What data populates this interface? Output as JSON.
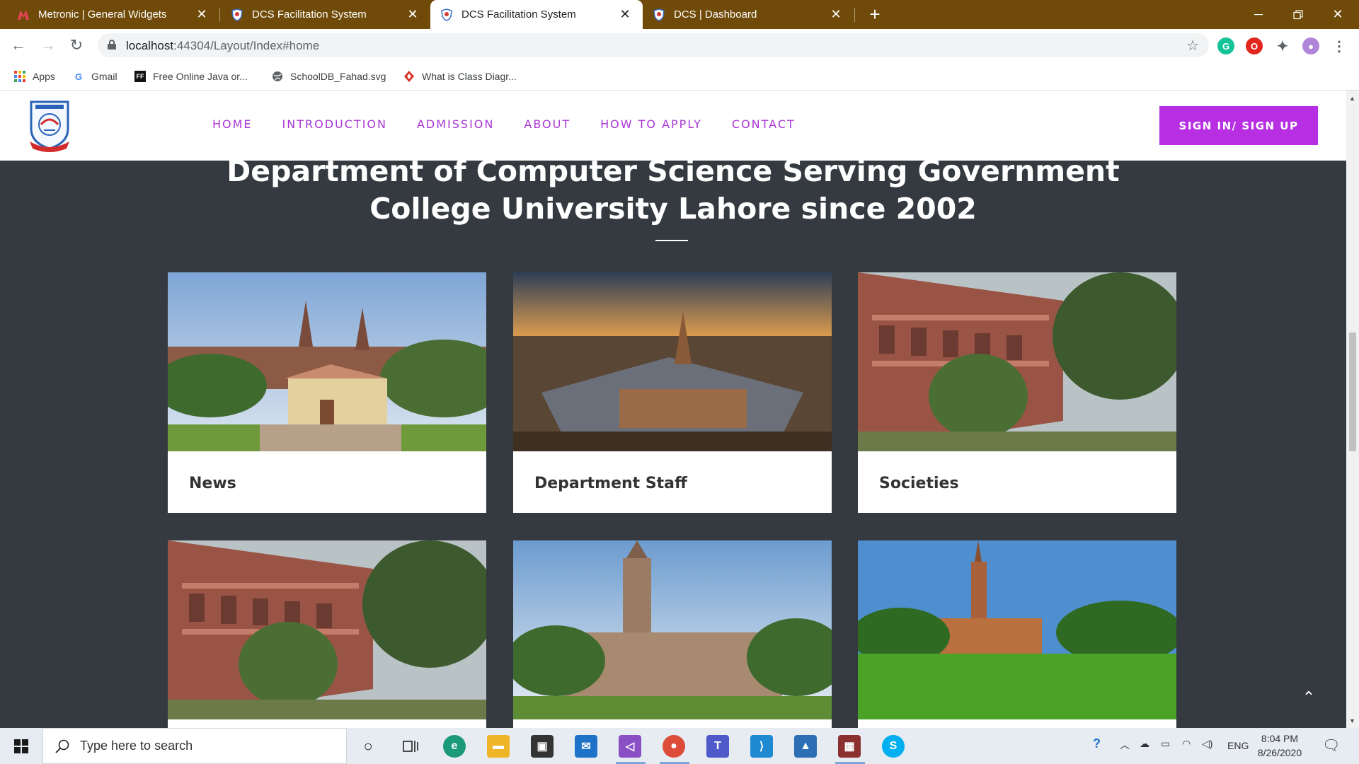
{
  "browser": {
    "tabs": [
      {
        "title": "Metronic | General Widgets",
        "active": false
      },
      {
        "title": "DCS Facilitation System",
        "active": false
      },
      {
        "title": "DCS Facilitation System",
        "active": true
      },
      {
        "title": "DCS | Dashboard",
        "active": false
      }
    ],
    "new_tab_symbol": "+",
    "url_host": "localhost",
    "url_rest": ":44304/Layout/Index#home",
    "bookmarks": [
      {
        "label": "Apps",
        "icon": "apps-grid-icon"
      },
      {
        "label": "Gmail",
        "icon": "google-icon"
      },
      {
        "label": "Free Online Java or...",
        "icon": "ff-icon"
      },
      {
        "label": "SchoolDB_Fahad.svg",
        "icon": "globe-icon"
      },
      {
        "label": "What is Class Diagr...",
        "icon": "diamond-icon"
      }
    ]
  },
  "site": {
    "nav": [
      "HOME",
      "INTRODUCTION",
      "ADMISSION",
      "ABOUT",
      "HOW TO APPLY",
      "CONTACT"
    ],
    "signin_label": "SIGN IN/ SIGN UP",
    "headline_line1": "Department of Computer Science Serving Government",
    "headline_line2": "College University Lahore since 2002",
    "cards": [
      {
        "caption": "News"
      },
      {
        "caption": "Department Staff"
      },
      {
        "caption": "Societies"
      },
      {
        "caption": ""
      },
      {
        "caption": ""
      },
      {
        "caption": ""
      }
    ],
    "accent_color": "#b72ee3"
  },
  "taskbar": {
    "search_placeholder": "Type here to search",
    "language": "ENG",
    "time": "8:04 PM",
    "date": "8/26/2020"
  }
}
